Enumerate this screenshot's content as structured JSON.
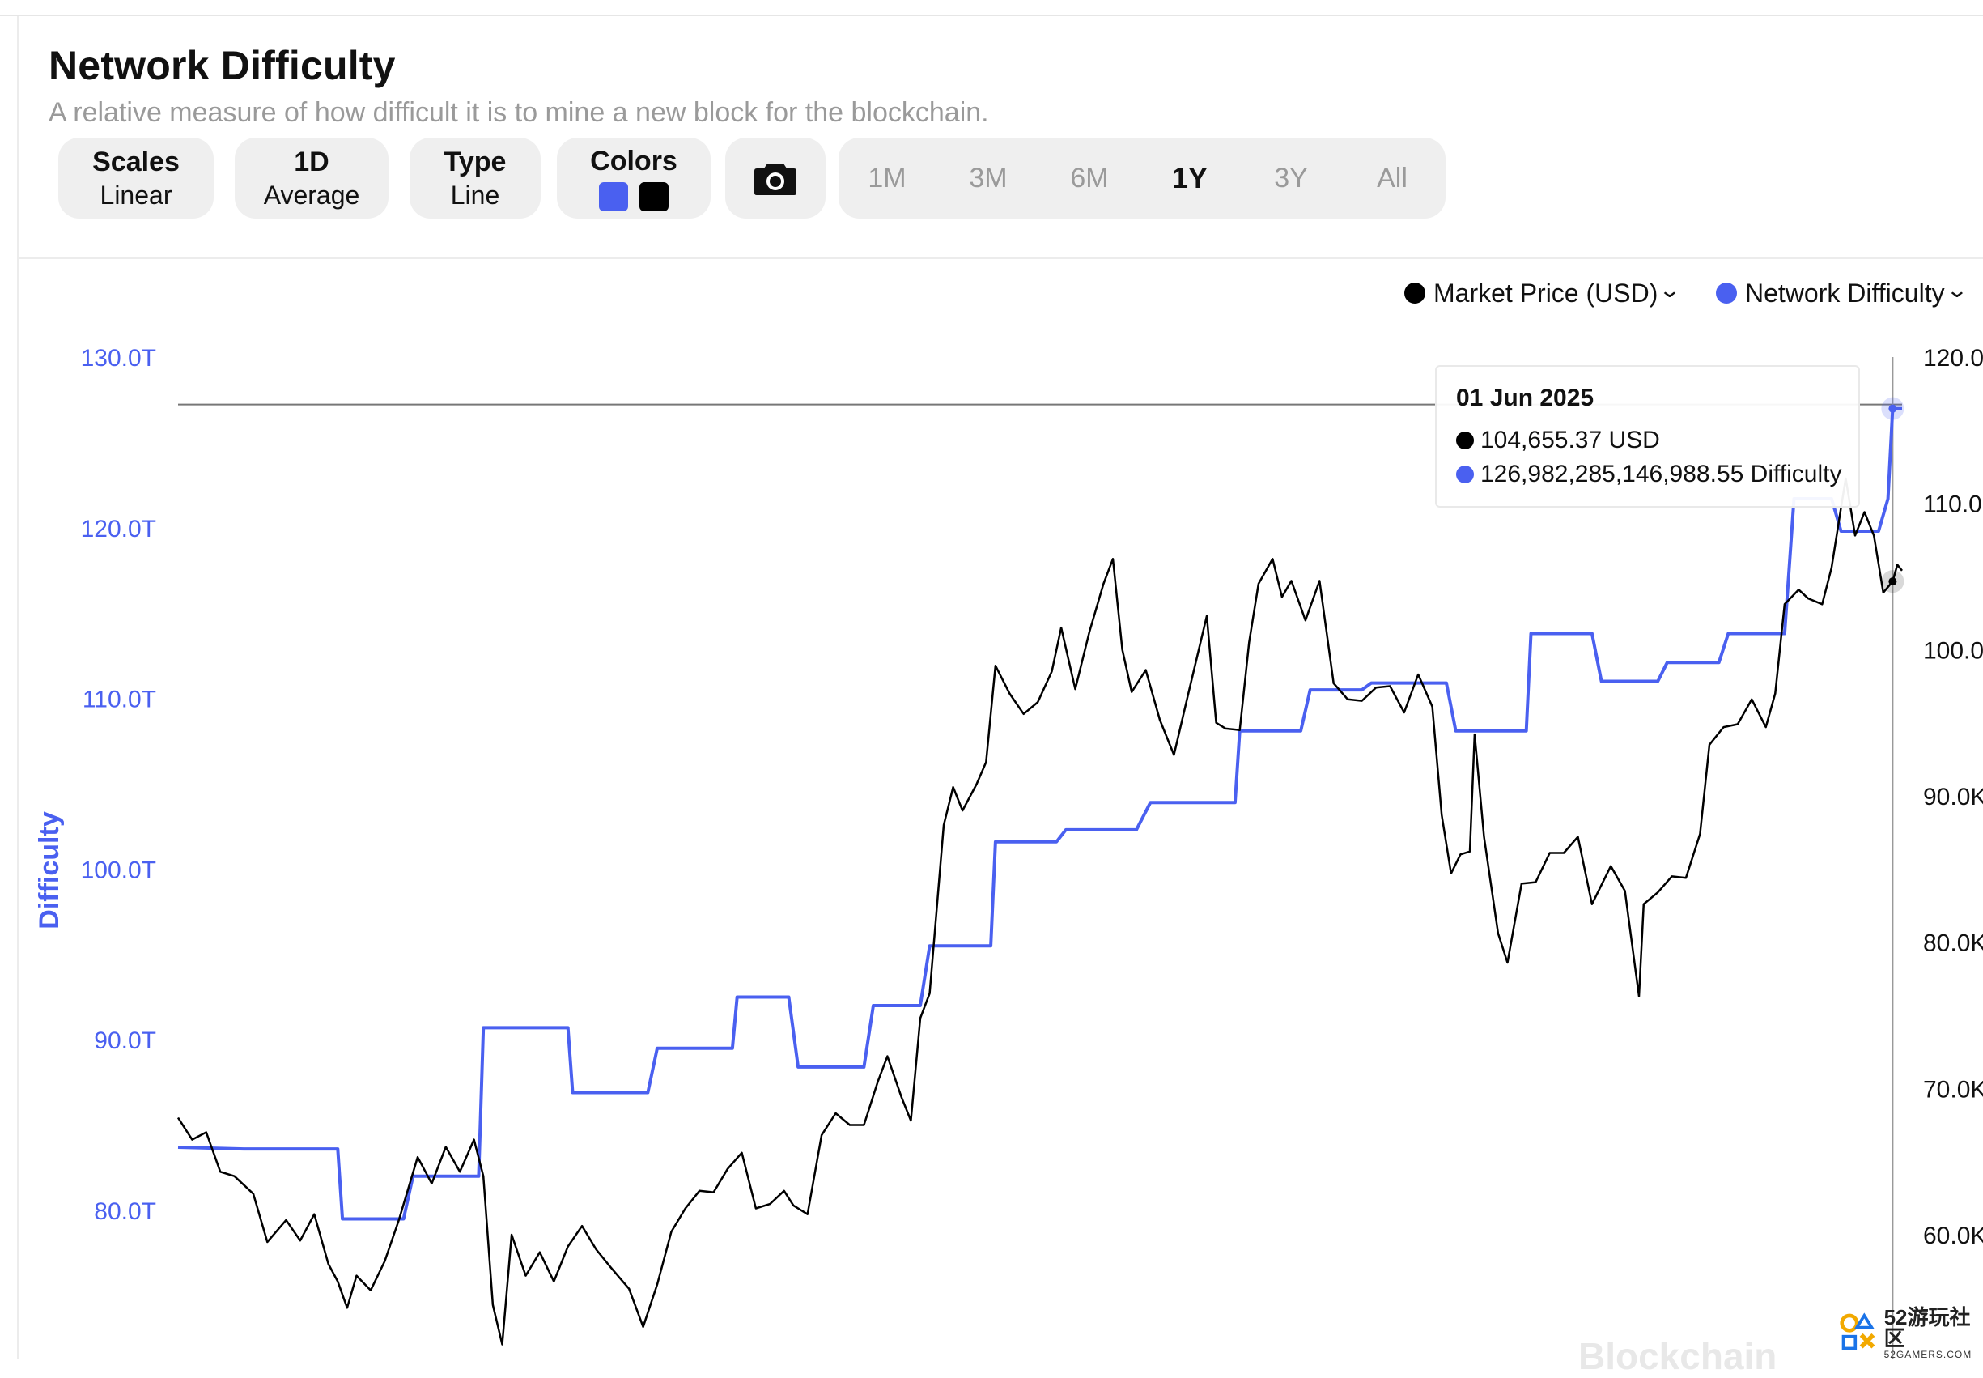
{
  "header": {
    "title": "Network Difficulty",
    "subtitle": "A relative measure of how difficult it is to mine a new block for the blockchain."
  },
  "controls": {
    "scales": {
      "label": "Scales",
      "value": "Linear"
    },
    "period": {
      "label": "1D",
      "value": "Average"
    },
    "type": {
      "label": "Type",
      "value": "Line"
    },
    "colors": {
      "label": "Colors",
      "swatches": [
        "#4a60f0",
        "#000000"
      ]
    },
    "camera_icon": "camera-icon",
    "ranges": [
      "1M",
      "3M",
      "6M",
      "1Y",
      "3Y",
      "All"
    ],
    "active_range": "1Y"
  },
  "legend": [
    {
      "label": "Market Price (USD)",
      "color": "#000000"
    },
    {
      "label": "Network Difficulty",
      "color": "#4a60f0"
    }
  ],
  "tooltip": {
    "date": "01 Jun 2025",
    "price": "104,655.37 USD",
    "difficulty": "126,982,285,146,988.55 Difficulty"
  },
  "watermark": "Blockchain",
  "badge": {
    "title": "52游玩社区",
    "sub": "52GAMERS.COM"
  },
  "chart_data": {
    "type": "line",
    "ylabel": "Difficulty",
    "left_axis": {
      "ticks": [
        "130.0T",
        "120.0T",
        "110.0T",
        "100.0T",
        "90.0T",
        "80.0T"
      ],
      "values": [
        130,
        120,
        110,
        100,
        90,
        80
      ],
      "color": "#4a60f0"
    },
    "right_axis": {
      "ticks": [
        "120.0",
        "110.0",
        "100.0",
        "90.0K",
        "80.0K",
        "70.0K",
        "60.0K"
      ],
      "values": [
        120,
        110,
        100,
        90,
        80,
        70,
        60
      ]
    },
    "x": {
      "start": "2024-06-01",
      "end": "2025-06-03",
      "unit": "date"
    },
    "series": [
      {
        "name": "Network Difficulty",
        "color": "#4a60f0",
        "unit": "T",
        "points": [
          [
            "2024-06-01",
            83.7
          ],
          [
            "2024-06-15",
            83.6
          ],
          [
            "2024-07-05",
            83.6
          ],
          [
            "2024-07-06",
            79.5
          ],
          [
            "2024-07-19",
            79.5
          ],
          [
            "2024-07-21",
            82.0
          ],
          [
            "2024-08-04",
            82.0
          ],
          [
            "2024-08-05",
            90.7
          ],
          [
            "2024-08-23",
            90.7
          ],
          [
            "2024-08-24",
            86.9
          ],
          [
            "2024-09-09",
            86.9
          ],
          [
            "2024-09-11",
            89.5
          ],
          [
            "2024-09-27",
            89.5
          ],
          [
            "2024-09-28",
            92.5
          ],
          [
            "2024-10-09",
            92.5
          ],
          [
            "2024-10-11",
            88.4
          ],
          [
            "2024-10-25",
            88.4
          ],
          [
            "2024-10-27",
            92.0
          ],
          [
            "2024-11-06",
            92.0
          ],
          [
            "2024-11-08",
            95.5
          ],
          [
            "2024-11-21",
            95.5
          ],
          [
            "2024-11-22",
            101.6
          ],
          [
            "2024-12-05",
            101.6
          ],
          [
            "2024-12-07",
            102.3
          ],
          [
            "2024-12-22",
            102.3
          ],
          [
            "2024-12-25",
            103.9
          ],
          [
            "2025-01-12",
            103.9
          ],
          [
            "2025-01-13",
            108.1
          ],
          [
            "2025-01-26",
            108.1
          ],
          [
            "2025-01-28",
            110.5
          ],
          [
            "2025-02-08",
            110.5
          ],
          [
            "2025-02-10",
            110.9
          ],
          [
            "2025-02-26",
            110.9
          ],
          [
            "2025-02-28",
            108.1
          ],
          [
            "2025-03-15",
            108.1
          ],
          [
            "2025-03-16",
            113.8
          ],
          [
            "2025-03-29",
            113.8
          ],
          [
            "2025-03-31",
            111.0
          ],
          [
            "2025-04-12",
            111.0
          ],
          [
            "2025-04-14",
            112.1
          ],
          [
            "2025-04-25",
            112.1
          ],
          [
            "2025-04-27",
            113.8
          ],
          [
            "2025-05-09",
            113.8
          ],
          [
            "2025-05-11",
            121.7
          ],
          [
            "2025-05-19",
            121.7
          ],
          [
            "2025-05-21",
            119.8
          ],
          [
            "2025-05-29",
            119.8
          ],
          [
            "2025-05-31",
            121.7
          ],
          [
            "2025-06-01",
            126.98
          ],
          [
            "2025-06-03",
            126.98
          ]
        ]
      },
      {
        "name": "Market Price (USD)",
        "color": "#000000",
        "unit": "K",
        "points": [
          [
            "2024-06-01",
            68.0
          ],
          [
            "2024-06-04",
            66.5
          ],
          [
            "2024-06-07",
            67.0
          ],
          [
            "2024-06-10",
            64.3
          ],
          [
            "2024-06-13",
            64.0
          ],
          [
            "2024-06-17",
            62.8
          ],
          [
            "2024-06-20",
            59.5
          ],
          [
            "2024-06-24",
            61.0
          ],
          [
            "2024-06-27",
            59.6
          ],
          [
            "2024-06-30",
            61.4
          ],
          [
            "2024-07-03",
            58.0
          ],
          [
            "2024-07-05",
            56.8
          ],
          [
            "2024-07-07",
            55.0
          ],
          [
            "2024-07-09",
            57.2
          ],
          [
            "2024-07-12",
            56.2
          ],
          [
            "2024-07-15",
            58.2
          ],
          [
            "2024-07-18",
            61.0
          ],
          [
            "2024-07-22",
            65.3
          ],
          [
            "2024-07-25",
            63.5
          ],
          [
            "2024-07-28",
            66.0
          ],
          [
            "2024-07-31",
            64.3
          ],
          [
            "2024-08-03",
            66.5
          ],
          [
            "2024-08-05",
            64.0
          ],
          [
            "2024-08-07",
            55.2
          ],
          [
            "2024-08-09",
            52.5
          ],
          [
            "2024-08-11",
            60.0
          ],
          [
            "2024-08-14",
            57.2
          ],
          [
            "2024-08-17",
            58.8
          ],
          [
            "2024-08-20",
            56.8
          ],
          [
            "2024-08-23",
            59.2
          ],
          [
            "2024-08-26",
            60.6
          ],
          [
            "2024-08-29",
            59.0
          ],
          [
            "2024-09-01",
            57.8
          ],
          [
            "2024-09-05",
            56.3
          ],
          [
            "2024-09-08",
            53.7
          ],
          [
            "2024-09-11",
            56.6
          ],
          [
            "2024-09-14",
            60.2
          ],
          [
            "2024-09-17",
            61.8
          ],
          [
            "2024-09-20",
            63.0
          ],
          [
            "2024-09-23",
            62.9
          ],
          [
            "2024-09-26",
            64.5
          ],
          [
            "2024-09-29",
            65.6
          ],
          [
            "2024-10-02",
            61.8
          ],
          [
            "2024-10-05",
            62.1
          ],
          [
            "2024-10-08",
            63.0
          ],
          [
            "2024-10-10",
            62.0
          ],
          [
            "2024-10-13",
            61.4
          ],
          [
            "2024-10-16",
            66.8
          ],
          [
            "2024-10-19",
            68.3
          ],
          [
            "2024-10-22",
            67.5
          ],
          [
            "2024-10-25",
            67.5
          ],
          [
            "2024-10-28",
            70.5
          ],
          [
            "2024-10-30",
            72.2
          ],
          [
            "2024-11-02",
            69.4
          ],
          [
            "2024-11-04",
            67.8
          ],
          [
            "2024-11-06",
            74.8
          ],
          [
            "2024-11-08",
            76.5
          ],
          [
            "2024-11-11",
            88.0
          ],
          [
            "2024-11-13",
            90.6
          ],
          [
            "2024-11-15",
            89.0
          ],
          [
            "2024-11-18",
            90.8
          ],
          [
            "2024-11-20",
            92.3
          ],
          [
            "2024-11-22",
            98.9
          ],
          [
            "2024-11-25",
            97.0
          ],
          [
            "2024-11-28",
            95.6
          ],
          [
            "2024-12-01",
            96.4
          ],
          [
            "2024-12-04",
            98.5
          ],
          [
            "2024-12-06",
            101.5
          ],
          [
            "2024-12-09",
            97.3
          ],
          [
            "2024-12-12",
            101.2
          ],
          [
            "2024-12-15",
            104.5
          ],
          [
            "2024-12-17",
            106.2
          ],
          [
            "2024-12-19",
            100.0
          ],
          [
            "2024-12-21",
            97.1
          ],
          [
            "2024-12-24",
            98.6
          ],
          [
            "2024-12-27",
            95.2
          ],
          [
            "2024-12-30",
            92.8
          ],
          [
            "2025-01-02",
            96.9
          ],
          [
            "2025-01-06",
            102.3
          ],
          [
            "2025-01-08",
            95.0
          ],
          [
            "2025-01-10",
            94.6
          ],
          [
            "2025-01-13",
            94.5
          ],
          [
            "2025-01-15",
            100.5
          ],
          [
            "2025-01-17",
            104.5
          ],
          [
            "2025-01-20",
            106.2
          ],
          [
            "2025-01-22",
            103.6
          ],
          [
            "2025-01-24",
            104.7
          ],
          [
            "2025-01-27",
            102.0
          ],
          [
            "2025-01-30",
            104.7
          ],
          [
            "2025-02-02",
            97.7
          ],
          [
            "2025-02-05",
            96.6
          ],
          [
            "2025-02-08",
            96.5
          ],
          [
            "2025-02-11",
            97.4
          ],
          [
            "2025-02-14",
            97.5
          ],
          [
            "2025-02-17",
            95.7
          ],
          [
            "2025-02-20",
            98.3
          ],
          [
            "2025-02-23",
            96.1
          ],
          [
            "2025-02-25",
            88.7
          ],
          [
            "2025-02-27",
            84.7
          ],
          [
            "2025-03-01",
            86.0
          ],
          [
            "2025-03-03",
            86.2
          ],
          [
            "2025-03-04",
            94.2
          ],
          [
            "2025-03-06",
            87.2
          ],
          [
            "2025-03-09",
            80.6
          ],
          [
            "2025-03-11",
            78.6
          ],
          [
            "2025-03-14",
            84.0
          ],
          [
            "2025-03-17",
            84.1
          ],
          [
            "2025-03-20",
            86.1
          ],
          [
            "2025-03-23",
            86.1
          ],
          [
            "2025-03-26",
            87.2
          ],
          [
            "2025-03-29",
            82.6
          ],
          [
            "2025-04-02",
            85.2
          ],
          [
            "2025-04-05",
            83.5
          ],
          [
            "2025-04-08",
            76.3
          ],
          [
            "2025-04-09",
            82.6
          ],
          [
            "2025-04-12",
            83.4
          ],
          [
            "2025-04-15",
            84.5
          ],
          [
            "2025-04-18",
            84.4
          ],
          [
            "2025-04-21",
            87.4
          ],
          [
            "2025-04-23",
            93.5
          ],
          [
            "2025-04-26",
            94.7
          ],
          [
            "2025-04-29",
            94.9
          ],
          [
            "2025-05-02",
            96.6
          ],
          [
            "2025-05-05",
            94.7
          ],
          [
            "2025-05-07",
            97.0
          ],
          [
            "2025-05-09",
            103.1
          ],
          [
            "2025-05-12",
            104.1
          ],
          [
            "2025-05-14",
            103.5
          ],
          [
            "2025-05-17",
            103.1
          ],
          [
            "2025-05-19",
            105.6
          ],
          [
            "2025-05-21",
            109.7
          ],
          [
            "2025-05-22",
            111.7
          ],
          [
            "2025-05-24",
            107.8
          ],
          [
            "2025-05-26",
            109.4
          ],
          [
            "2025-05-28",
            107.8
          ],
          [
            "2025-05-30",
            103.9
          ],
          [
            "2025-06-01",
            104.66
          ],
          [
            "2025-06-02",
            105.8
          ],
          [
            "2025-06-03",
            105.4
          ]
        ]
      }
    ],
    "crosshair_date": "2025-06-01",
    "legend_position": "top-right",
    "grid": false
  }
}
